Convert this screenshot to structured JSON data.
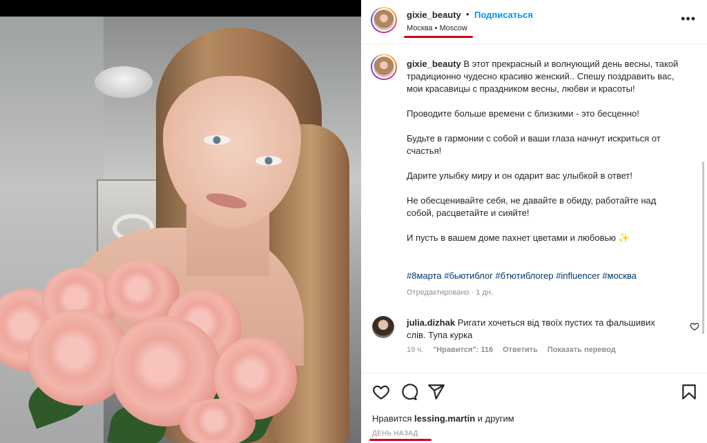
{
  "post": {
    "username": "gixie_beauty",
    "separator": "•",
    "follow_label": "Подписаться",
    "location": "Москва • Moscow",
    "more_label": "•••"
  },
  "caption": {
    "username": "gixie_beauty",
    "paragraphs": [
      "В этот прекрасный и волнующий день весны, такой традиционно чудесно красиво женский.. Спешу поздравить вас, мои красавицы с праздником весны, любви и красоты!",
      "Проводите больше времени с близкими - это бесценно!",
      "Будьте в гармонии с собой и ваши глаза начнут искриться от счастья!",
      "Дарите улыбку миру и он одарит вас улыбкой в ответ!",
      "Не обесценивайте себя, не давайте в обиду, работайте над собой, расцветайте и сияйте!",
      "И пусть в вашем доме пахнет цветами и любовью ✨"
    ],
    "hashtags": "#8марта #бьютиблог #бтютиблогер #influencer #москва",
    "edited": "Отредактировано · 1 дн."
  },
  "comment": {
    "username": "julia.dizhak",
    "text": "Ригати хочеться від твоїх пустих та фальшивих слів. Тупа курка",
    "time": "19 ч.",
    "likes": "\"Нравится\": 116",
    "reply_label": "Ответить",
    "translate_label": "Показать перевод"
  },
  "footer": {
    "likes_prefix": "Нравится",
    "likes_user": "lessing.martin",
    "likes_suffix": "и другим",
    "time": "ДЕНЬ НАЗАД"
  },
  "colors": {
    "accent": "#0095f6",
    "annotation_red": "#d0021b",
    "hashtag": "#00376b"
  },
  "icons": [
    "heart-icon",
    "comment-icon",
    "share-icon",
    "bookmark-icon",
    "more-icon"
  ]
}
